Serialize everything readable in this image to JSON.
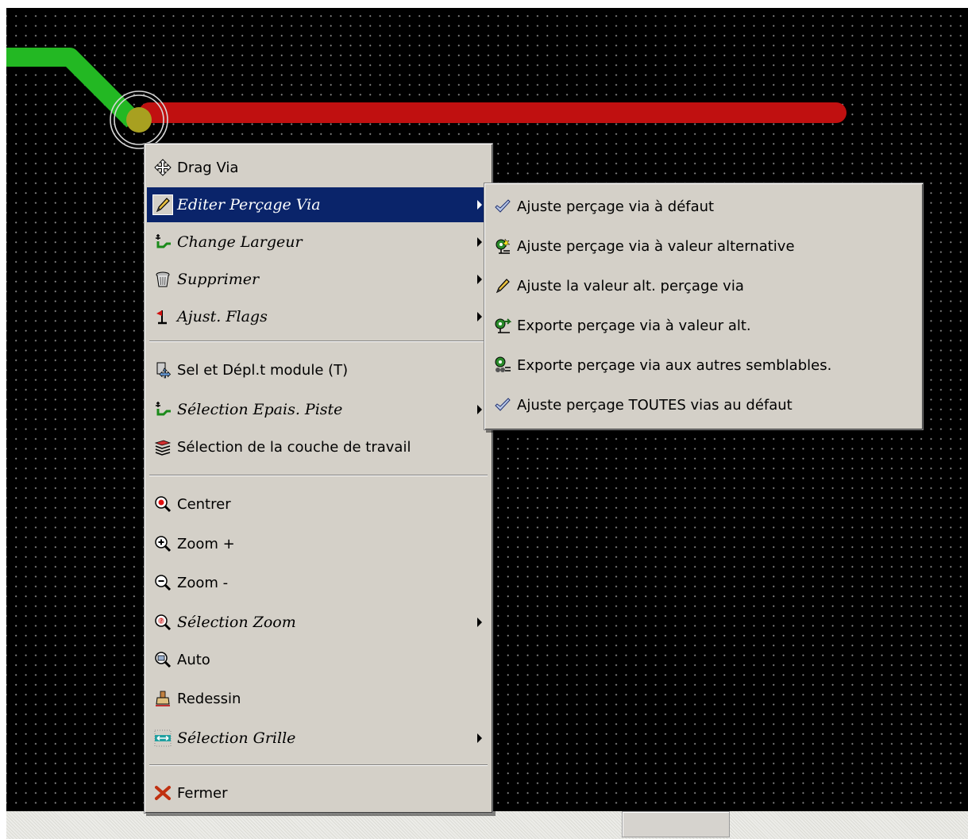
{
  "main_menu": {
    "items": [
      {
        "label": "Drag Via",
        "icon": "move-icon",
        "italic": false,
        "submenu": false
      },
      {
        "label": "Editer Perçage Via",
        "icon": "pencil-icon",
        "italic": true,
        "submenu": true,
        "active": true
      },
      {
        "label": "Change Largeur",
        "icon": "track-width-icon",
        "italic": true,
        "submenu": true
      },
      {
        "label": "Supprimer",
        "icon": "trash-icon",
        "italic": true,
        "submenu": true
      },
      {
        "label": "Ajust. Flags",
        "icon": "flag-icon",
        "italic": true,
        "submenu": true
      },
      {
        "label": "Sel et Dépl.t module (T)",
        "icon": "move-module-icon",
        "italic": false,
        "submenu": false
      },
      {
        "label": "Sélection Epais. Piste",
        "icon": "track-width-icon",
        "italic": true,
        "submenu": true
      },
      {
        "label": "Sélection de la couche de travail",
        "icon": "layers-icon",
        "italic": false,
        "submenu": false
      },
      {
        "label": "Centrer",
        "icon": "zoom-center-icon",
        "italic": false,
        "submenu": false
      },
      {
        "label": "Zoom +",
        "icon": "zoom-in-icon",
        "italic": false,
        "submenu": false
      },
      {
        "label": "Zoom -",
        "icon": "zoom-out-icon",
        "italic": false,
        "submenu": false
      },
      {
        "label": "Sélection Zoom",
        "icon": "zoom-select-icon",
        "italic": true,
        "submenu": true
      },
      {
        "label": "Auto",
        "icon": "zoom-auto-icon",
        "italic": false,
        "submenu": false
      },
      {
        "label": "Redessin",
        "icon": "redraw-icon",
        "italic": false,
        "submenu": false
      },
      {
        "label": "Sélection Grille",
        "icon": "grid-icon",
        "italic": true,
        "submenu": true
      },
      {
        "label": "Fermer",
        "icon": "close-icon",
        "italic": false,
        "submenu": false
      }
    ]
  },
  "sub_menu": {
    "items": [
      {
        "label": "Ajuste perçage via à défaut",
        "icon": "checkmark-icon"
      },
      {
        "label": "Ajuste perçage via à valeur alternative",
        "icon": "via-alt-icon"
      },
      {
        "label": "Ajuste la valeur alt. perçage via",
        "icon": "pencil-icon"
      },
      {
        "label": "Exporte perçage via à valeur alt.",
        "icon": "via-export-icon"
      },
      {
        "label": "Exporte perçage via aux autres semblables.",
        "icon": "via-export-similar-icon"
      },
      {
        "label": "Ajuste perçage TOUTES vias au défaut",
        "icon": "checkmark-icon"
      }
    ]
  },
  "colors": {
    "canvas_bg": "#000000",
    "grid_dot": "#8a8a8a",
    "track_green": "#23b823",
    "track_red": "#c01010",
    "menu_bg": "#d4d0c8",
    "highlight": "#0a246a"
  }
}
